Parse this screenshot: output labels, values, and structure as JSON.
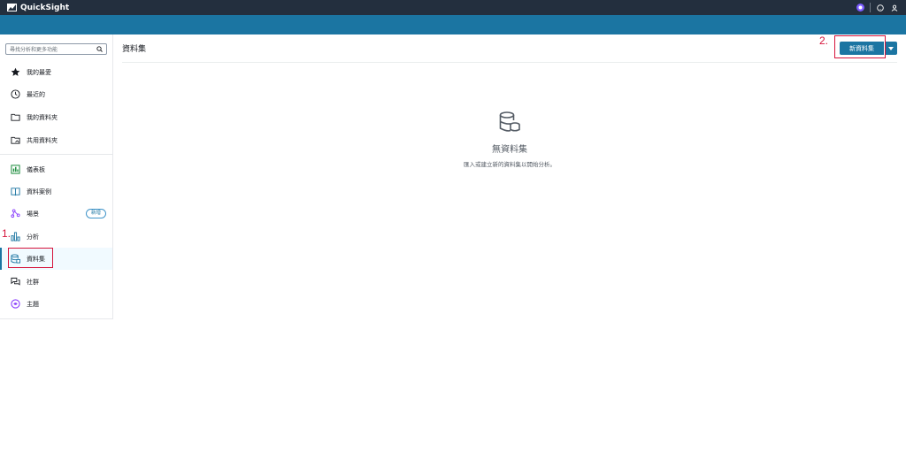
{
  "app": {
    "name": "QuickSight"
  },
  "sidebar": {
    "search_placeholder": "尋找分析和更多功能",
    "items": [
      {
        "label": "我的最愛",
        "icon": "star-icon"
      },
      {
        "label": "最近的",
        "icon": "clock-icon"
      },
      {
        "label": "我的資料夾",
        "icon": "folder-icon"
      },
      {
        "label": "共用資料夾",
        "icon": "shared-folder-icon"
      },
      {
        "label": "儀表板",
        "icon": "dashboard-icon"
      },
      {
        "label": "資料案例",
        "icon": "book-icon"
      },
      {
        "label": "場景",
        "icon": "scenario-icon",
        "badge": "新增"
      },
      {
        "label": "分析",
        "icon": "analysis-icon"
      },
      {
        "label": "資料集",
        "icon": "dataset-icon",
        "active": true
      },
      {
        "label": "社群",
        "icon": "community-icon"
      },
      {
        "label": "主題",
        "icon": "theme-icon"
      }
    ]
  },
  "main": {
    "title": "資料集",
    "new_button_label": "新資料集",
    "empty_title": "無資料集",
    "empty_subtitle": "匯入或建立新的資料集以開始分析。"
  },
  "annotations": {
    "step1": "1.",
    "step2": "2."
  },
  "colors": {
    "topbar": "#232f3e",
    "banner": "#1b75a2",
    "primary": "#1b75a2",
    "highlight": "#d6143b"
  }
}
